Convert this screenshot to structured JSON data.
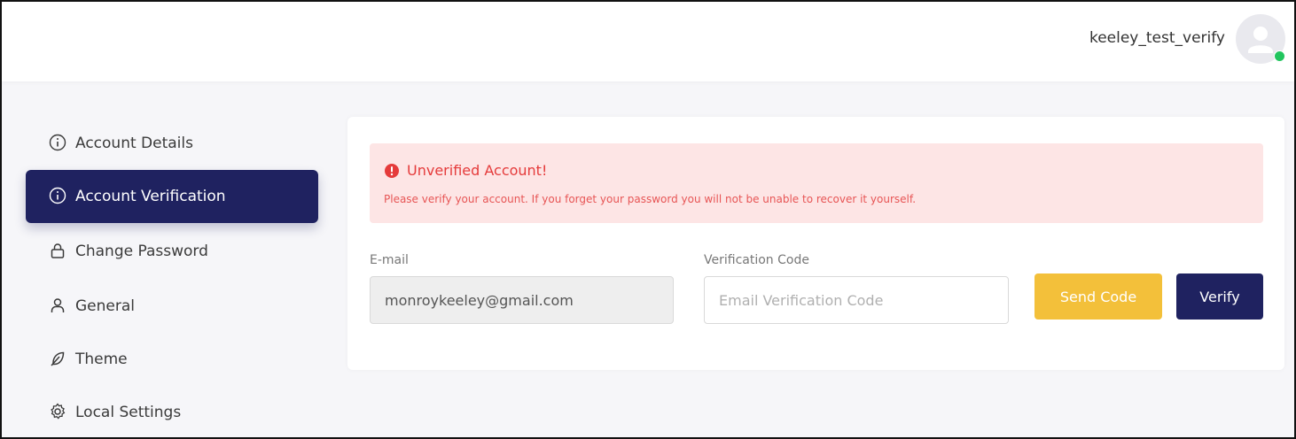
{
  "header": {
    "username": "keeley_test_verify"
  },
  "sidebar": {
    "items": [
      {
        "label": "Account Details",
        "icon": "info-icon"
      },
      {
        "label": "Account Verification",
        "icon": "info-icon",
        "active": true
      },
      {
        "label": "Change Password",
        "icon": "lock-icon"
      },
      {
        "label": "General",
        "icon": "user-icon"
      },
      {
        "label": "Theme",
        "icon": "feather-icon"
      },
      {
        "label": "Local Settings",
        "icon": "gear-icon"
      }
    ]
  },
  "alert": {
    "title": "Unverified Account!",
    "message": "Please verify your account. If you forget your password you will not be unable to recover it yourself."
  },
  "form": {
    "email_label": "E-mail",
    "email_value": "monroykeeley@gmail.com",
    "code_label": "Verification Code",
    "code_placeholder": "Email Verification Code",
    "send_label": "Send Code",
    "verify_label": "Verify"
  },
  "colors": {
    "primary": "#1f2260",
    "warning": "#f3c03a",
    "alert_bg": "#fde5e5",
    "alert_text": "#e53b3b",
    "online": "#22c55e"
  }
}
